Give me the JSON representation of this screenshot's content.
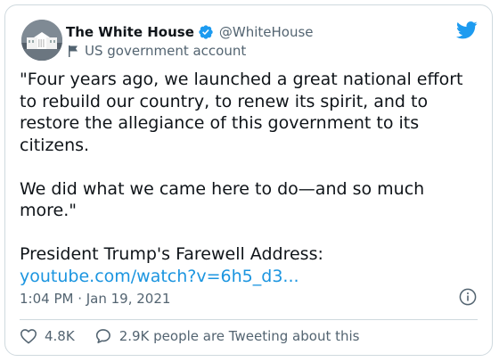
{
  "tweet": {
    "author": {
      "display_name": "The White House",
      "handle": "@WhiteHouse",
      "account_label": "US government account",
      "verified": true
    },
    "paragraphs": [
      "\"Four years ago, we launched a great national effort to rebuild our country, to renew its spirit, and to restore the allegiance of this government to its citizens.",
      "We did what we came here to do—and so much more.\""
    ],
    "footer_text": "President Trump's Farewell Address:",
    "link_text": "youtube.com/watch?v=6h5_d3...",
    "timestamp": "1:04 PM · Jan 19, 2021",
    "likes": "4.8K",
    "conversation": "2.9K people are Tweeting about this"
  },
  "colors": {
    "link": "#1b95e0",
    "verified_badge": "#1d9bf0",
    "twitter_logo": "#1d9bf0",
    "secondary_text": "#536471"
  },
  "icons": [
    "white-house-avatar",
    "verified-badge-icon",
    "flag-icon",
    "twitter-logo-icon",
    "info-icon",
    "heart-icon",
    "speech-bubble-icon"
  ]
}
